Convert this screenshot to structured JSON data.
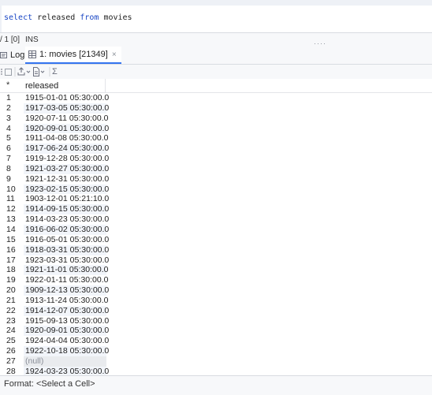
{
  "editor": {
    "kw1": "select",
    "col": " released ",
    "kw2": "from",
    "table": " movies"
  },
  "status": {
    "position": "/ 1  [0]",
    "mode": "INS"
  },
  "tabs": {
    "log_label": "Log",
    "result_label": "1: movies [21349]",
    "close_glyph": "×"
  },
  "toolbar": {
    "sum_glyph": "Σ"
  },
  "grid": {
    "row_header": "*",
    "column": "released",
    "rows": [
      {
        "n": "1",
        "v": "1915-01-01 05:30:00.0"
      },
      {
        "n": "2",
        "v": "1917-03-05 05:30:00.0"
      },
      {
        "n": "3",
        "v": "1920-07-11 05:30:00.0"
      },
      {
        "n": "4",
        "v": "1920-09-01 05:30:00.0"
      },
      {
        "n": "5",
        "v": "1911-04-08 05:30:00.0"
      },
      {
        "n": "6",
        "v": "1917-06-24 05:30:00.0"
      },
      {
        "n": "7",
        "v": "1919-12-28 05:30:00.0"
      },
      {
        "n": "8",
        "v": "1921-03-27 05:30:00.0"
      },
      {
        "n": "9",
        "v": "1921-12-31 05:30:00.0"
      },
      {
        "n": "10",
        "v": "1923-02-15 05:30:00.0"
      },
      {
        "n": "11",
        "v": "1903-12-01 05:21:10.0"
      },
      {
        "n": "12",
        "v": "1914-09-15 05:30:00.0"
      },
      {
        "n": "13",
        "v": "1914-03-23 05:30:00.0"
      },
      {
        "n": "14",
        "v": "1916-06-02 05:30:00.0"
      },
      {
        "n": "15",
        "v": "1916-05-01 05:30:00.0"
      },
      {
        "n": "16",
        "v": "1918-03-31 05:30:00.0"
      },
      {
        "n": "17",
        "v": "1923-03-31 05:30:00.0"
      },
      {
        "n": "18",
        "v": "1921-11-01 05:30:00.0"
      },
      {
        "n": "19",
        "v": "1922-01-11 05:30:00.0"
      },
      {
        "n": "20",
        "v": "1909-12-13 05:30:00.0"
      },
      {
        "n": "21",
        "v": "1913-11-24 05:30:00.0"
      },
      {
        "n": "22",
        "v": "1914-12-07 05:30:00.0"
      },
      {
        "n": "23",
        "v": "1915-09-13 05:30:00.0"
      },
      {
        "n": "24",
        "v": "1920-09-01 05:30:00.0"
      },
      {
        "n": "25",
        "v": "1924-04-04 05:30:00.0"
      },
      {
        "n": "26",
        "v": "1922-10-18 05:30:00.0"
      },
      {
        "n": "27",
        "v": "(null)"
      },
      {
        "n": "28",
        "v": "1924-03-23 05:30:00.0"
      }
    ]
  },
  "footer": {
    "format": "Format: <Select a Cell>"
  },
  "colors": {
    "accent": "#3574f0",
    "keyword": "#1a47c5"
  }
}
